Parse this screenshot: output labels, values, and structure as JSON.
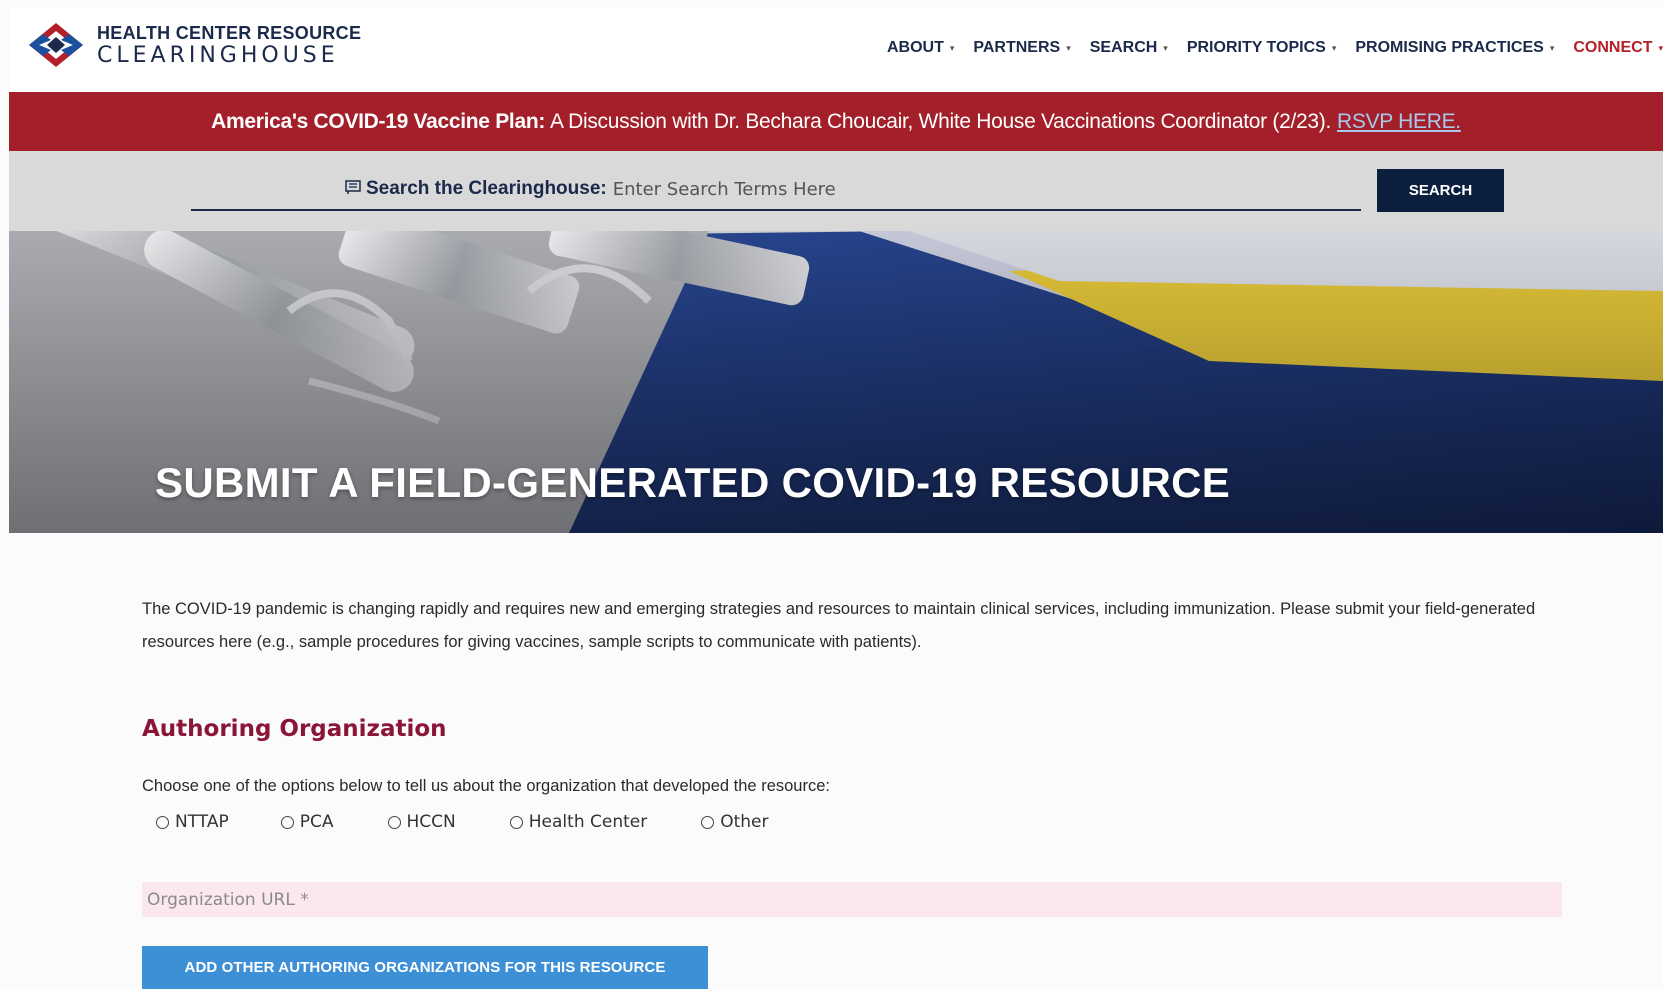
{
  "header": {
    "logo_line1": "HEALTH CENTER RESOURCE",
    "logo_line2": "CLEARINGHOUSE",
    "nav": [
      {
        "label": "ABOUT"
      },
      {
        "label": "PARTNERS"
      },
      {
        "label": "SEARCH"
      },
      {
        "label": "PRIORITY TOPICS"
      },
      {
        "label": "PROMISING PRACTICES"
      },
      {
        "label": "CONNECT"
      }
    ],
    "caret": "▾"
  },
  "announcement": {
    "bold": "America's COVID-19 Vaccine Plan:",
    "text": "A Discussion with Dr. Bechara Choucair, White House Vaccinations Coordinator (2/23).",
    "link": "RSVP HERE."
  },
  "search": {
    "icon": "list-icon",
    "label": "Search the Clearinghouse:",
    "placeholder": "Enter Search Terms Here",
    "button": "SEARCH"
  },
  "hero": {
    "title": "SUBMIT A FIELD-GENERATED COVID-19 RESOURCE"
  },
  "main": {
    "intro": "The COVID-19 pandemic is changing rapidly and requires new and emerging strategies and resources to maintain clinical services, including immunization. Please submit your field-generated resources here (e.g., sample procedures for giving vaccines, sample scripts to communicate with patients).",
    "section_heading": "Authoring Organization",
    "choose_text": "Choose one of the options below to tell us about the organization that developed the resource:",
    "options": [
      "NTTAP",
      "PCA",
      "HCCN",
      "Health Center",
      "Other"
    ],
    "url_placeholder": "Organization URL *",
    "add_button": "ADD OTHER AUTHORING ORGANIZATIONS FOR THIS RESOURCE"
  },
  "colors": {
    "navy": "#1b2a4a",
    "red": "#a3202a",
    "accent_blue": "#3d8fd6",
    "heading_maroon": "#8a1538"
  }
}
